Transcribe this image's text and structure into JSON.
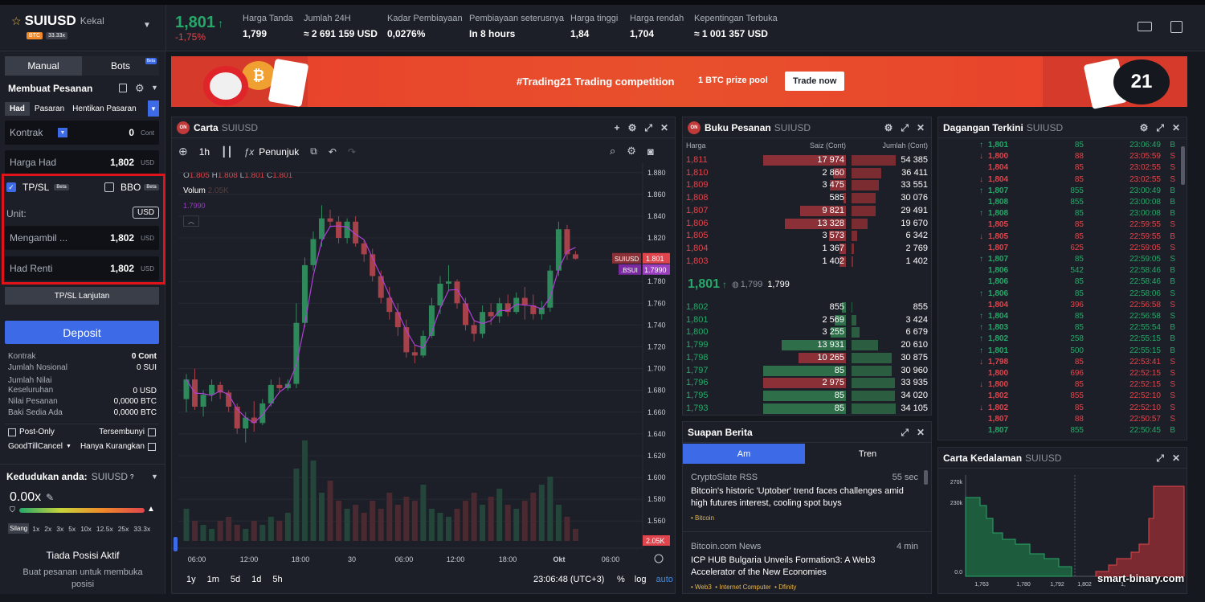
{
  "colors": {
    "bg": "#15181f",
    "panel": "#1c1f27",
    "green": "#26a86a",
    "red": "#e0454d",
    "accent": "#3d6be8",
    "highlight": "#e0121a"
  },
  "ticker": {
    "symbol": "SUIUSD",
    "mode": "Kekal",
    "badge_btc": "BTC",
    "badge_lev": "33.33x",
    "price": "1,801",
    "change": "-1,75%",
    "stats": [
      {
        "label": "Harga Tanda",
        "value": "1,799"
      },
      {
        "label": "Jumlah 24H",
        "value": "≈ 2 691 159 USD"
      },
      {
        "label": "Kadar Pembiayaan",
        "value": "0,0276%"
      },
      {
        "label": "Pembiayaan seterusnya",
        "value": "In 8 hours"
      },
      {
        "label": "Harga tinggi",
        "value": "1,84"
      },
      {
        "label": "Harga rendah",
        "value": "1,704"
      },
      {
        "label": "Kepentingan Terbuka",
        "value": "≈ 1 001 357 USD"
      }
    ]
  },
  "banner": {
    "title": "#Trading21 Trading competition",
    "prize": "1 BTC prize pool",
    "cta": "Trade now",
    "badge": "21"
  },
  "order": {
    "tabs": [
      "Manual",
      "Bots"
    ],
    "beta": "Beta",
    "title": "Membuat Pesanan",
    "types": [
      "Had",
      "Pasaran",
      "Hentikan Pasaran"
    ],
    "contract_label": "Kontrak",
    "contract_value": "0",
    "contract_unit": "Cont",
    "limit_label": "Harga Had",
    "limit_value": "1,802",
    "limit_unit": "USD",
    "tpsl": "TP/SL",
    "bbo": "BBO",
    "unit_label": "Unit:",
    "unit_value": "USD",
    "tp_label": "Mengambil ...",
    "tp_value": "1,802",
    "sl_label": "Had Renti",
    "sl_value": "1,802",
    "usd": "USD",
    "advanced": "TP/SL Lanjutan",
    "deposit": "Deposit",
    "summary": [
      {
        "label": "Kontrak",
        "value": "0 Cont"
      },
      {
        "label": "Jumlah Nosional",
        "value": "0 SUI"
      },
      {
        "label": "Jumlah Nilai Keseluruhan",
        "value": "0 USD"
      },
      {
        "label": "Nilai Pesanan",
        "value": "0,0000 BTC"
      },
      {
        "label": "Baki Sedia Ada",
        "value": "0,0000 BTC"
      }
    ],
    "post_only": "Post-Only",
    "hidden": "Tersembunyi",
    "gtc": "GoodTillCancel",
    "reduce": "Hanya Kurangkan"
  },
  "position": {
    "title": "Kedudukan anda:",
    "symbol": "SUIUSD",
    "leverage": "0.00x",
    "cross": "Silang",
    "levs": [
      "1x",
      "2x",
      "3x",
      "5x",
      "10x",
      "12.5x",
      "25x",
      "33.3x"
    ],
    "none_title": "Tiada Posisi Aktif",
    "none_sub": "Buat pesanan untuk membuka posisi"
  },
  "chart": {
    "title": "Carta",
    "symbol": "SUIUSD",
    "interval": "1h",
    "indicator": "Penunjuk",
    "ohlc": {
      "o": "1.805",
      "h": "1.808",
      "l": "1.801",
      "c": "1.801"
    },
    "volume_label": "Volum",
    "volume_value": "2.05K",
    "ma_value": "1.7990",
    "price_tag": "1.801",
    "price_tag_label": "SUIUSD",
    "bsui_tag": "1.7990",
    "bsui_label": ".BSUI",
    "vol_tag": "2.05K",
    "ranges": [
      "1y",
      "1m",
      "5d",
      "1d",
      "5h"
    ],
    "clock": "23:06:48 (UTC+3)",
    "opts": [
      "%",
      "log",
      "auto"
    ]
  },
  "chart_data": {
    "type": "candlestick",
    "ylim": [
      1.555,
      1.885
    ],
    "y_ticks": [
      "1.880",
      "1.860",
      "1.840",
      "1.820",
      "1.800",
      "1.780",
      "1.760",
      "1.740",
      "1.720",
      "1.700",
      "1.680",
      "1.660",
      "1.640",
      "1.620",
      "1.600",
      "1.580",
      "1.560"
    ],
    "x_ticks": [
      "06:00",
      "12:00",
      "18:00",
      "30",
      "06:00",
      "12:00",
      "18:00",
      "Okt",
      "06:00"
    ],
    "ohlc": [
      [
        1.672,
        1.695,
        1.66,
        1.69
      ],
      [
        1.69,
        1.7,
        1.662,
        1.665
      ],
      [
        1.665,
        1.68,
        1.656,
        1.676
      ],
      [
        1.676,
        1.69,
        1.67,
        1.685
      ],
      [
        1.685,
        1.688,
        1.672,
        1.678
      ],
      [
        1.678,
        1.68,
        1.66,
        1.665
      ],
      [
        1.665,
        1.668,
        1.64,
        1.645
      ],
      [
        1.645,
        1.66,
        1.632,
        1.655
      ],
      [
        1.655,
        1.67,
        1.642,
        1.65
      ],
      [
        1.65,
        1.672,
        1.648,
        1.668
      ],
      [
        1.668,
        1.69,
        1.665,
        1.685
      ],
      [
        1.685,
        1.692,
        1.678,
        1.682
      ],
      [
        1.682,
        1.69,
        1.68,
        1.686
      ],
      [
        1.686,
        1.76,
        1.682,
        1.742
      ],
      [
        1.742,
        1.802,
        1.738,
        1.795
      ],
      [
        1.795,
        1.826,
        1.79,
        1.819
      ],
      [
        1.819,
        1.85,
        1.812,
        1.838
      ],
      [
        1.838,
        1.846,
        1.83,
        1.835
      ],
      [
        1.835,
        1.84,
        1.815,
        1.82
      ],
      [
        1.82,
        1.838,
        1.815,
        1.835
      ],
      [
        1.835,
        1.84,
        1.812,
        1.815
      ],
      [
        1.815,
        1.818,
        1.798,
        1.805
      ],
      [
        1.805,
        1.81,
        1.78,
        1.785
      ],
      [
        1.785,
        1.79,
        1.76,
        1.765
      ],
      [
        1.765,
        1.775,
        1.745,
        1.752
      ],
      [
        1.752,
        1.76,
        1.73,
        1.738
      ],
      [
        1.738,
        1.745,
        1.71,
        1.715
      ],
      [
        1.715,
        1.722,
        1.705,
        1.712
      ],
      [
        1.712,
        1.735,
        1.71,
        1.73
      ],
      [
        1.73,
        1.765,
        1.728,
        1.758
      ],
      [
        1.758,
        1.785,
        1.75,
        1.778
      ],
      [
        1.778,
        1.795,
        1.772,
        1.78
      ],
      [
        1.78,
        1.782,
        1.755,
        1.76
      ],
      [
        1.76,
        1.765,
        1.735,
        1.74
      ],
      [
        1.74,
        1.745,
        1.725,
        1.732
      ],
      [
        1.732,
        1.758,
        1.728,
        1.752
      ],
      [
        1.752,
        1.76,
        1.74,
        1.748
      ],
      [
        1.748,
        1.765,
        1.742,
        1.76
      ],
      [
        1.76,
        1.768,
        1.748,
        1.752
      ],
      [
        1.752,
        1.77,
        1.75,
        1.765
      ],
      [
        1.765,
        1.775,
        1.745,
        1.758
      ],
      [
        1.758,
        1.768,
        1.745,
        1.75
      ],
      [
        1.75,
        1.762,
        1.745,
        1.756
      ],
      [
        1.756,
        1.795,
        1.752,
        1.79
      ],
      [
        1.79,
        1.835,
        1.785,
        1.828
      ],
      [
        1.828,
        1.832,
        1.8,
        1.805
      ],
      [
        1.805,
        1.808,
        1.8,
        1.801
      ]
    ],
    "volumes": [
      8,
      5,
      4,
      3,
      5,
      6,
      4,
      3,
      5,
      4,
      6,
      5,
      7,
      18,
      25,
      20,
      12,
      15,
      10,
      8,
      9,
      7,
      10,
      8,
      12,
      9,
      11,
      10,
      14,
      8,
      7,
      6,
      8,
      10,
      12,
      9,
      11,
      13,
      9,
      8,
      10,
      12,
      14,
      16,
      9,
      6,
      3
    ]
  },
  "orderbook": {
    "title": "Buku Pesanan",
    "symbol": "SUIUSD",
    "cols": [
      "Harga",
      "Saiz (Cont)",
      "Jumlah (Cont)"
    ],
    "asks": [
      {
        "p": "1,811",
        "s": "17 974",
        "t": "54 385",
        "sw": 100,
        "tw": 100
      },
      {
        "p": "1,810",
        "s": "2 860",
        "t": "36 411",
        "sw": 16,
        "tw": 67
      },
      {
        "p": "1,809",
        "s": "3 475",
        "t": "33 551",
        "sw": 19,
        "tw": 62
      },
      {
        "p": "1,808",
        "s": "585",
        "t": "30 076",
        "sw": 3,
        "tw": 55
      },
      {
        "p": "1,807",
        "s": "9 821",
        "t": "29 491",
        "sw": 55,
        "tw": 54
      },
      {
        "p": "1,806",
        "s": "13 328",
        "t": "19 670",
        "sw": 74,
        "tw": 36
      },
      {
        "p": "1,805",
        "s": "3 573",
        "t": "6 342",
        "sw": 20,
        "tw": 12
      },
      {
        "p": "1,804",
        "s": "1 367",
        "t": "2 769",
        "sw": 8,
        "tw": 5
      },
      {
        "p": "1,803",
        "s": "1 402",
        "t": "1 402",
        "sw": 8,
        "tw": 3
      }
    ],
    "mid": "1,801",
    "mid_mark": "1,799",
    "mid_last": "1,799",
    "bids": [
      {
        "p": "1,802",
        "s": "855",
        "t": "855",
        "sw": 5,
        "tw": 2,
        "sc": "g"
      },
      {
        "p": "1,801",
        "s": "2 569",
        "t": "3 424",
        "sw": 14,
        "tw": 10,
        "sc": "g"
      },
      {
        "p": "1,800",
        "s": "3 255",
        "t": "6 679",
        "sw": 18,
        "tw": 19,
        "sc": "g"
      },
      {
        "p": "1,799",
        "s": "13 931",
        "t": "20 610",
        "sw": 78,
        "tw": 60,
        "sc": "g"
      },
      {
        "p": "1,798",
        "s": "10 265",
        "t": "30 875",
        "sw": 57,
        "tw": 90,
        "sc": "r"
      },
      {
        "p": "1,797",
        "s": "85",
        "t": "30 960",
        "sw": 100,
        "tw": 90,
        "sc": "g"
      },
      {
        "p": "1,796",
        "s": "2 975",
        "t": "33 935",
        "sw": 100,
        "tw": 99,
        "sc": "r"
      },
      {
        "p": "1,795",
        "s": "85",
        "t": "34 020",
        "sw": 100,
        "tw": 99,
        "sc": "g"
      },
      {
        "p": "1,793",
        "s": "85",
        "t": "34 105",
        "sw": 100,
        "tw": 100,
        "sc": "g"
      }
    ]
  },
  "trades": {
    "title": "Dagangan Terkini",
    "symbol": "SUIUSD",
    "rows": [
      {
        "d": "up",
        "p": "1,801",
        "s": "85",
        "t": "23:06:49",
        "side": "B"
      },
      {
        "d": "dn",
        "p": "1,800",
        "s": "88",
        "t": "23:05:59",
        "side": "S"
      },
      {
        "d": "",
        "p": "1,804",
        "s": "85",
        "t": "23:02:55",
        "side": "S"
      },
      {
        "d": "dn",
        "p": "1,804",
        "s": "85",
        "t": "23:02:55",
        "side": "S"
      },
      {
        "d": "up",
        "p": "1,807",
        "s": "855",
        "t": "23:00:49",
        "side": "B"
      },
      {
        "d": "",
        "p": "1,808",
        "s": "855",
        "t": "23:00:08",
        "side": "B"
      },
      {
        "d": "up",
        "p": "1,808",
        "s": "85",
        "t": "23:00:08",
        "side": "B"
      },
      {
        "d": "",
        "p": "1,805",
        "s": "85",
        "t": "22:59:55",
        "side": "S"
      },
      {
        "d": "dn",
        "p": "1,805",
        "s": "85",
        "t": "22:59:55",
        "side": "B"
      },
      {
        "d": "",
        "p": "1,807",
        "s": "625",
        "t": "22:59:05",
        "side": "S"
      },
      {
        "d": "up",
        "p": "1,807",
        "s": "85",
        "t": "22:59:05",
        "side": "S"
      },
      {
        "d": "",
        "p": "1,806",
        "s": "542",
        "t": "22:58:46",
        "side": "B"
      },
      {
        "d": "",
        "p": "1,806",
        "s": "85",
        "t": "22:58:46",
        "side": "B"
      },
      {
        "d": "up",
        "p": "1,806",
        "s": "85",
        "t": "22:58:06",
        "side": "S"
      },
      {
        "d": "",
        "p": "1,804",
        "s": "396",
        "t": "22:56:58",
        "side": "S"
      },
      {
        "d": "up",
        "p": "1,804",
        "s": "85",
        "t": "22:56:58",
        "side": "S"
      },
      {
        "d": "up",
        "p": "1,803",
        "s": "85",
        "t": "22:55:54",
        "side": "B"
      },
      {
        "d": "up",
        "p": "1,802",
        "s": "258",
        "t": "22:55:15",
        "side": "B"
      },
      {
        "d": "up",
        "p": "1,801",
        "s": "500",
        "t": "22:55:15",
        "side": "B"
      },
      {
        "d": "dn",
        "p": "1,798",
        "s": "85",
        "t": "22:53:41",
        "side": "S"
      },
      {
        "d": "",
        "p": "1,800",
        "s": "696",
        "t": "22:52:15",
        "side": "S"
      },
      {
        "d": "dn",
        "p": "1,800",
        "s": "85",
        "t": "22:52:15",
        "side": "S"
      },
      {
        "d": "",
        "p": "1,802",
        "s": "855",
        "t": "22:52:10",
        "side": "S"
      },
      {
        "d": "dn",
        "p": "1,802",
        "s": "85",
        "t": "22:52:10",
        "side": "S"
      },
      {
        "d": "",
        "p": "1,807",
        "s": "88",
        "t": "22:50:57",
        "side": "S"
      },
      {
        "d": "",
        "p": "1,807",
        "s": "855",
        "t": "22:50:45",
        "side": "B"
      }
    ]
  },
  "news": {
    "title": "Suapan Berita",
    "tabs": [
      "Am",
      "Tren"
    ],
    "items": [
      {
        "source": "CryptoSlate RSS",
        "time": "55 sec",
        "headline": "Bitcoin's historic 'Uptober' trend faces challenges amid high futures interest, cooling spot buys",
        "tags": "• Bitcoin"
      },
      {
        "source": "Bitcoin.com News",
        "time": "4 min",
        "headline": "ICP HUB Bulgaria Unveils Formation3: A Web3 Accelerator of the New Economies",
        "tags": "• Web3  • Internet Computer  • Dfinity"
      }
    ]
  },
  "depth": {
    "title": "Carta Kedalaman",
    "symbol": "SUIUSD",
    "y_ticks": [
      "270k",
      "230k",
      "0.0"
    ],
    "x_ticks": [
      "1,763",
      "1,780",
      "1,792",
      "1,802",
      "1,"
    ],
    "watermark": "smart-binary.com"
  }
}
